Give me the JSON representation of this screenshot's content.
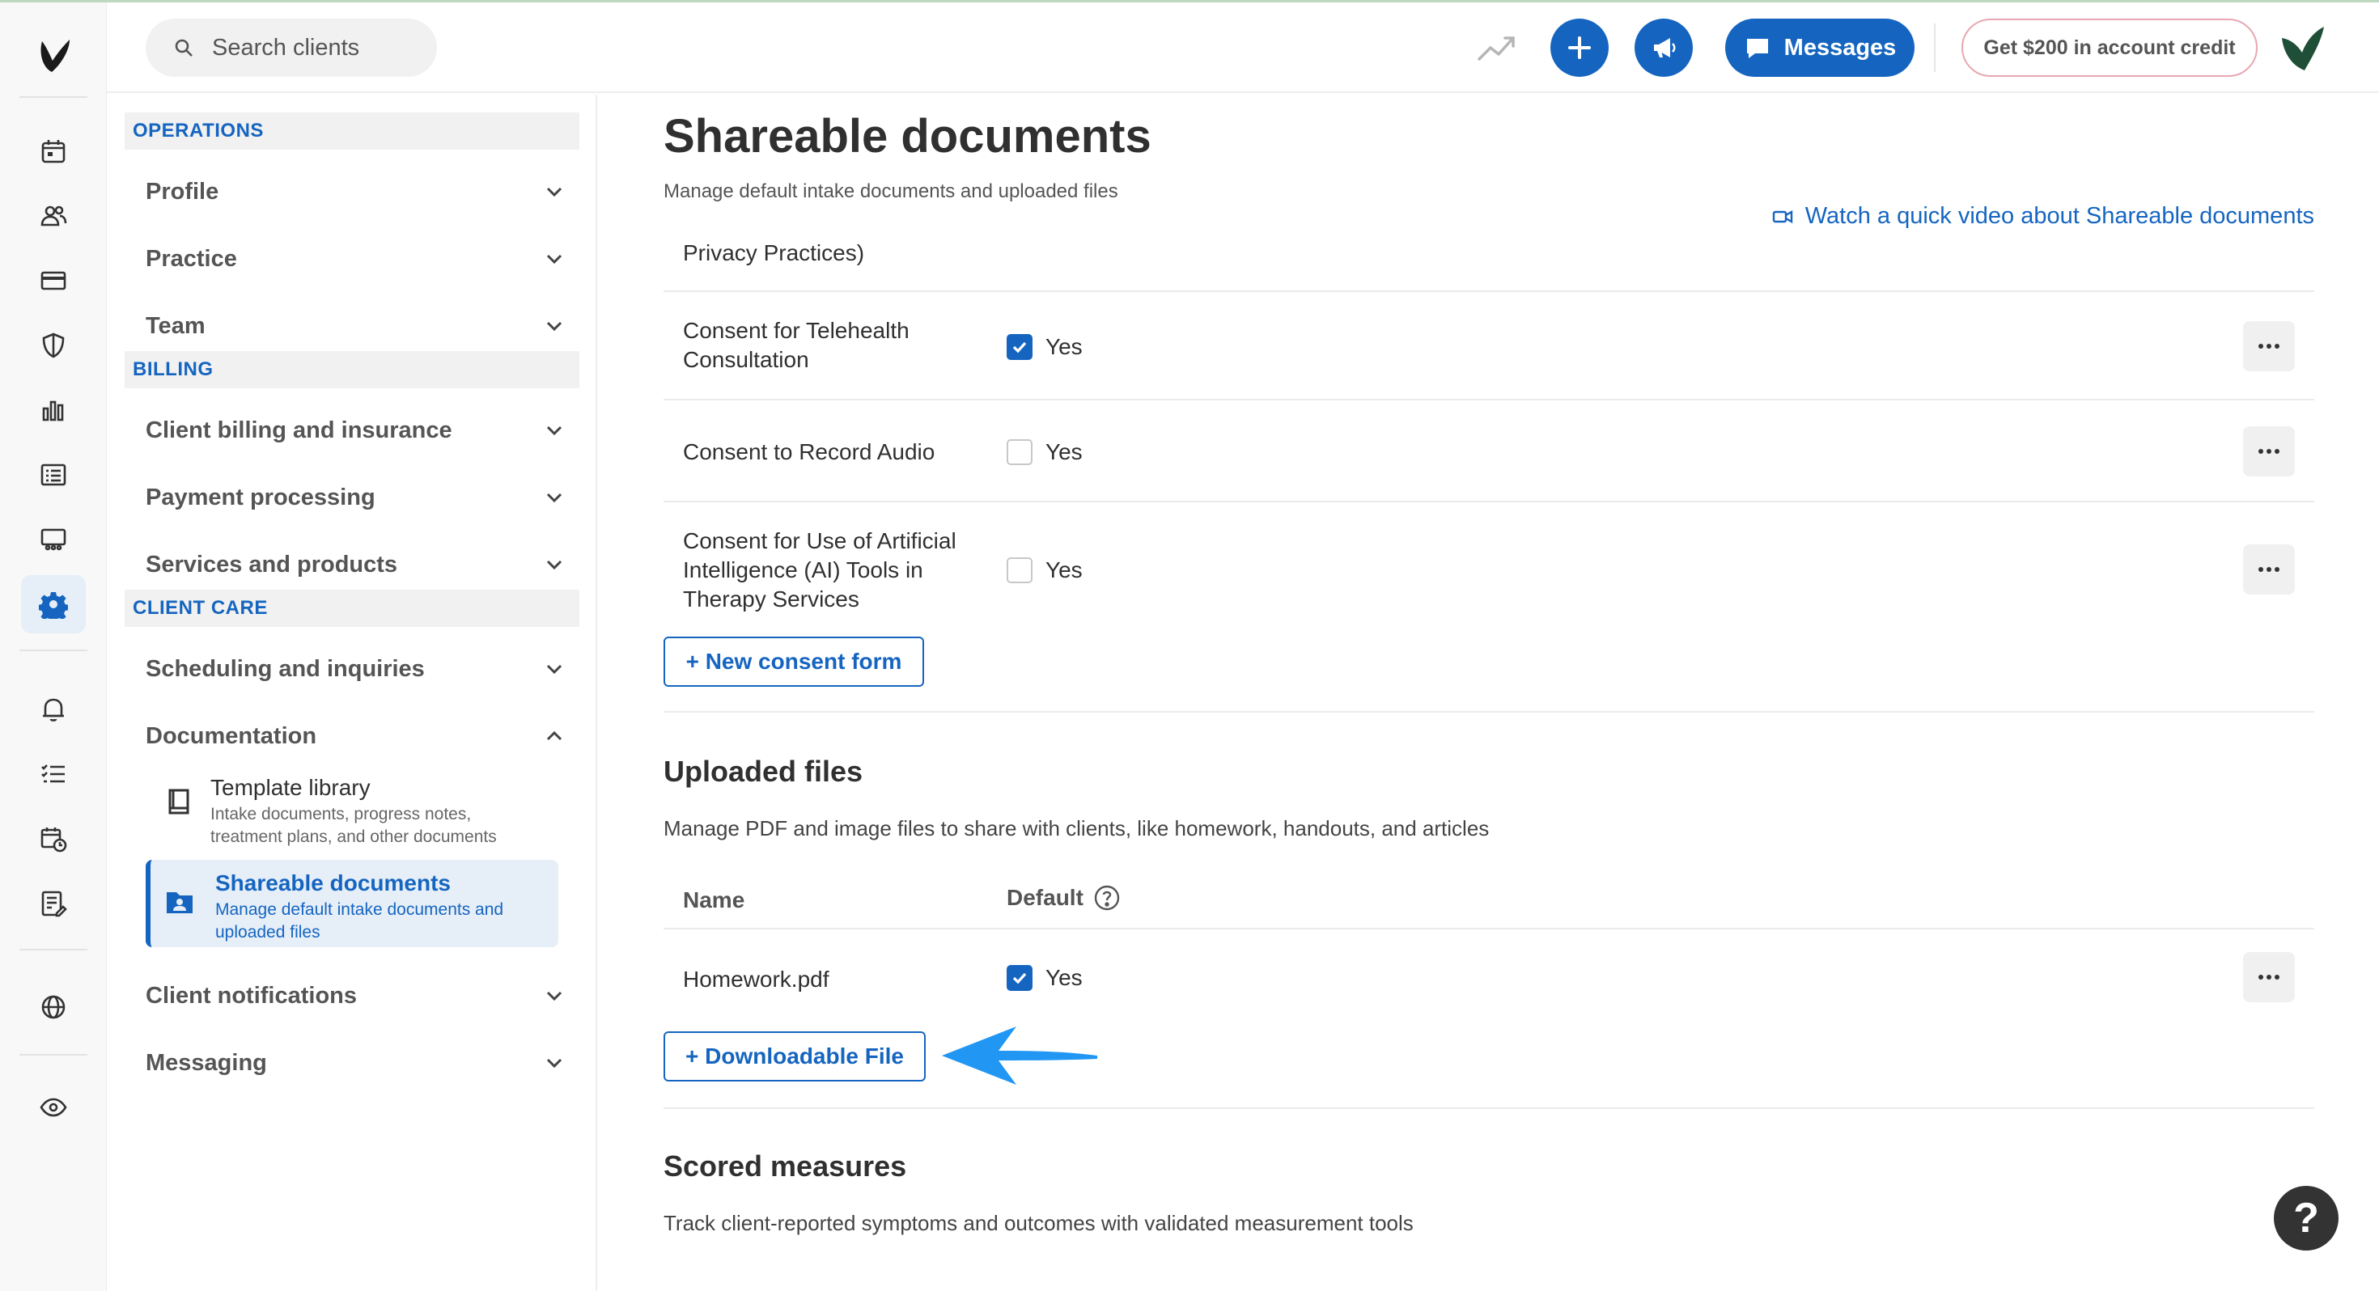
{
  "search": {
    "placeholder": "Search clients"
  },
  "topbar": {
    "messages_label": "Messages",
    "credit_label": "Get $200 in account credit"
  },
  "nav": {
    "sections": {
      "operations": "OPERATIONS",
      "billing": "BILLING",
      "client_care": "CLIENT CARE"
    },
    "items": {
      "profile": "Profile",
      "practice": "Practice",
      "team": "Team",
      "client_billing": "Client billing and insurance",
      "payment_processing": "Payment processing",
      "services_products": "Services and products",
      "scheduling": "Scheduling and inquiries",
      "documentation": "Documentation",
      "client_notifications": "Client notifications",
      "messaging": "Messaging"
    },
    "sub": {
      "template_library": {
        "title": "Template library",
        "desc": "Intake documents, progress notes, treatment plans, and other documents"
      },
      "shareable_documents": {
        "title": "Shareable documents",
        "desc": "Manage default intake documents and uploaded files"
      }
    }
  },
  "page": {
    "title": "Shareable documents",
    "subtitle": "Manage default intake documents and uploaded files",
    "video_link": "Watch a quick video about Shareable documents"
  },
  "consents": {
    "partial_row": "Privacy Practices)",
    "rows": [
      {
        "name": "Consent for Telehealth Consultation",
        "default": true,
        "label": "Yes"
      },
      {
        "name": "Consent to Record Audio",
        "default": false,
        "label": "Yes"
      },
      {
        "name": "Consent for Use of Artificial Intelligence (AI) Tools in Therapy Services",
        "default": false,
        "label": "Yes"
      }
    ],
    "new_button": "+ New consent form"
  },
  "uploaded": {
    "title": "Uploaded files",
    "desc": "Manage PDF and image files to share with clients, like homework, handouts, and articles",
    "col_name": "Name",
    "col_default": "Default",
    "rows": [
      {
        "name": "Homework.pdf",
        "default": true,
        "label": "Yes"
      }
    ],
    "add_button": "+ Downloadable File"
  },
  "scored": {
    "title": "Scored measures",
    "desc": "Track client-reported symptoms and outcomes with validated measurement tools"
  },
  "help_label": "?",
  "colors": {
    "primary": "#1565c0",
    "brand_green": "#1f4f37",
    "credit_border": "#e8a7b2",
    "annotation_arrow": "#2196f3"
  },
  "icons": [
    "calendar-icon",
    "clients-icon",
    "billing-card-icon",
    "shield-icon",
    "analytics-icon",
    "list-icon",
    "marketing-icon",
    "settings-gear-icon",
    "bell-icon",
    "tasks-icon",
    "calendar-clock-icon",
    "notes-icon",
    "globe-icon",
    "eye-icon"
  ]
}
